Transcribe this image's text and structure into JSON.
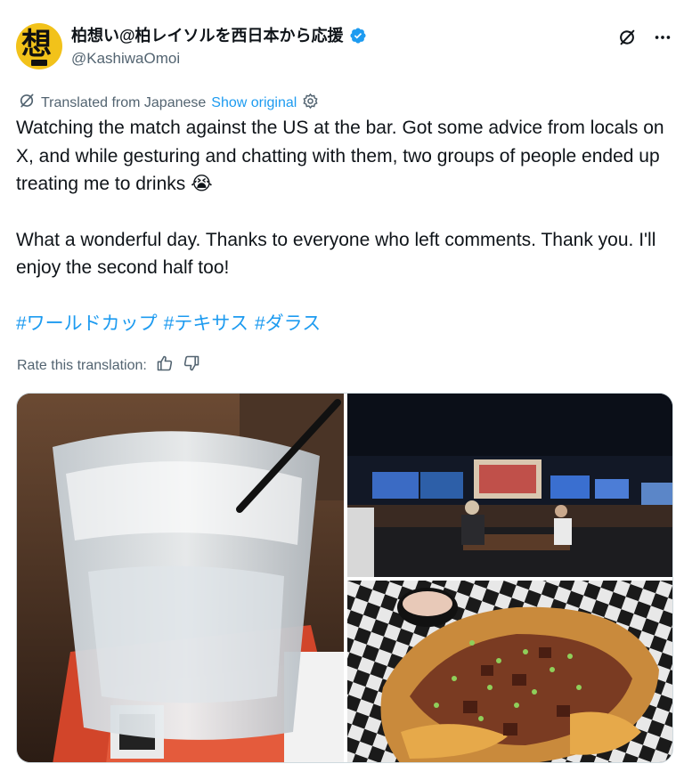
{
  "author": {
    "display_name": "柏想い@柏レイソルを西日本から応援",
    "handle": "@KashiwaOmoi",
    "avatar_glyph": "想"
  },
  "translation": {
    "label": "Translated from Japanese",
    "show_original": "Show original"
  },
  "body": {
    "paragraph1": "Watching the match against the US at the bar. Got some advice from locals on X, and while gesturing and chatting with them, two groups of people ended up treating me to drinks 😭",
    "paragraph2": "What a wonderful day. Thanks to everyone who left comments. Thank you. I'll enjoy the second half too!",
    "hashtags": [
      "#ワールドカップ",
      "#テキサス",
      "#ダラス"
    ]
  },
  "rate": {
    "label": "Rate this translation:"
  },
  "colors": {
    "link": "#1d9bf0",
    "secondary_text": "#536471",
    "verified": "#1d9bf0",
    "avatar_bg": "#f2c21a"
  },
  "icons": [
    "verified-badge-icon",
    "grok-icon",
    "more-icon",
    "translate-icon",
    "settings-icon",
    "thumbs-up-icon",
    "thumbs-down-icon"
  ]
}
